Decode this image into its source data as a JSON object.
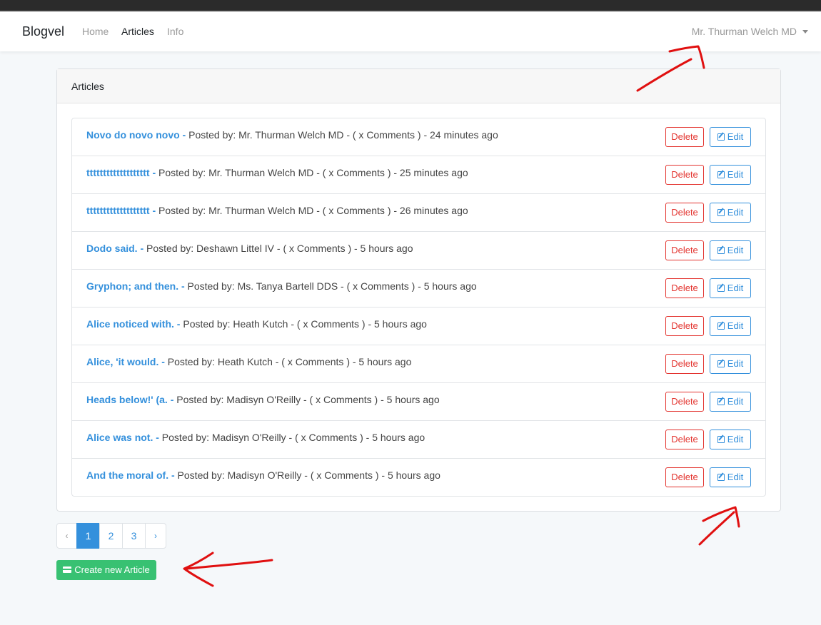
{
  "navbar": {
    "brand": "Blogvel",
    "links": [
      "Home",
      "Articles",
      "Info"
    ],
    "user": "Mr. Thurman Welch MD"
  },
  "card": {
    "title": "Articles"
  },
  "articles": [
    {
      "title": "Novo do novo novo -",
      "meta": " Posted by: Mr. Thurman Welch MD - ( x Comments ) - 24 minutes ago"
    },
    {
      "title": "ttttttttttttttttttt -",
      "meta": " Posted by: Mr. Thurman Welch MD - ( x Comments ) - 25 minutes ago"
    },
    {
      "title": "ttttttttttttttttttt -",
      "meta": " Posted by: Mr. Thurman Welch MD - ( x Comments ) - 26 minutes ago"
    },
    {
      "title": "Dodo said. -",
      "meta": " Posted by: Deshawn Littel IV - ( x Comments ) - 5 hours ago"
    },
    {
      "title": "Gryphon; and then. -",
      "meta": " Posted by: Ms. Tanya Bartell DDS - ( x Comments ) - 5 hours ago"
    },
    {
      "title": "Alice noticed with. -",
      "meta": " Posted by: Heath Kutch - ( x Comments ) - 5 hours ago"
    },
    {
      "title": "Alice, 'it would. -",
      "meta": " Posted by: Heath Kutch - ( x Comments ) - 5 hours ago"
    },
    {
      "title": "Heads below!' (a. -",
      "meta": " Posted by: Madisyn O'Reilly - ( x Comments ) - 5 hours ago"
    },
    {
      "title": "Alice was not. -",
      "meta": " Posted by: Madisyn O'Reilly - ( x Comments ) - 5 hours ago"
    },
    {
      "title": "And the moral of. -",
      "meta": " Posted by: Madisyn O'Reilly - ( x Comments ) - 5 hours ago"
    }
  ],
  "buttons": {
    "delete": "Delete",
    "edit": "Edit",
    "create": "Create new Article"
  },
  "pagination": {
    "prev": "‹",
    "pages": [
      "1",
      "2",
      "3"
    ],
    "next": "›",
    "current": "1"
  },
  "colors": {
    "primary": "#3490dc",
    "danger": "#e3342f",
    "success": "#38c172",
    "annotation": "#e01010"
  },
  "icons": {
    "edit": "edit-icon",
    "create": "card-icon",
    "dropdown": "caret-down-icon"
  }
}
